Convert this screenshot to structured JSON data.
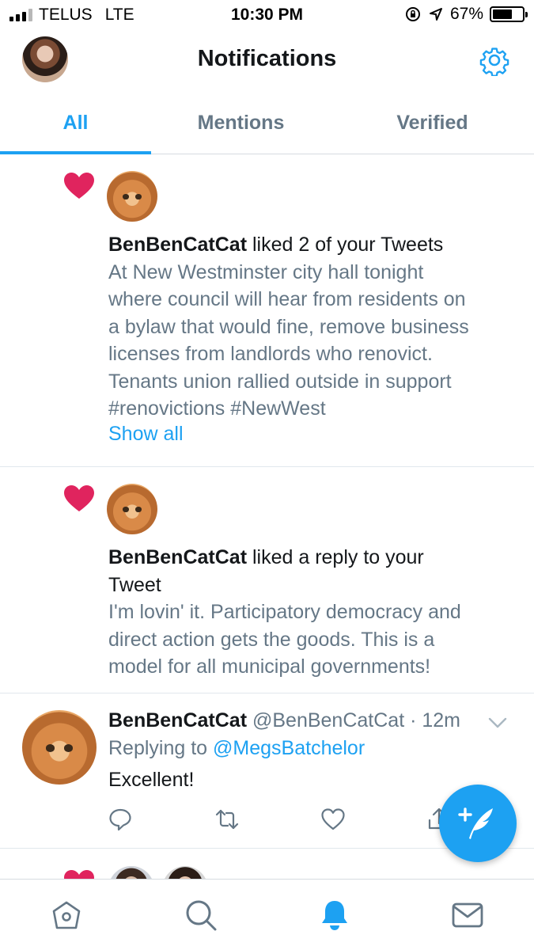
{
  "status_bar": {
    "carrier": "TELUS",
    "network": "LTE",
    "time": "10:30 PM",
    "battery": "67%",
    "battery_level": 0.67
  },
  "header": {
    "title": "Notifications",
    "avatar_icon": "profile-avatar",
    "settings_icon": "gear-icon"
  },
  "tabs": [
    {
      "label": "All",
      "active": true
    },
    {
      "label": "Mentions",
      "active": false
    },
    {
      "label": "Verified",
      "active": false
    }
  ],
  "notifications": [
    {
      "type": "like",
      "actor": "BenBenCatCat",
      "action": " liked 2 of your Tweets",
      "snippet_lines": [
        "At New Westminster city hall tonight",
        "where council will hear from residents on",
        "a bylaw that would fine, remove business",
        "licenses from landlords who renovict.",
        "Tenants union rallied outside in support",
        "#renovictions #NewWest"
      ],
      "show_all": "Show all"
    },
    {
      "type": "like",
      "actor": "BenBenCatCat",
      "action_line1": " liked a reply to your",
      "action_line2": "Tweet",
      "snippet_lines": [
        "I'm lovin' it. Participatory democracy and",
        "direct action gets the goods. This is a",
        "model for all municipal governments!"
      ]
    }
  ],
  "reply_tweet": {
    "name": "BenBenCatCat",
    "handle": "@BenBenCatCat",
    "separator": " · ",
    "time": "12m",
    "replying_prefix": "Replying to ",
    "replying_to": "@MegsBatchelor",
    "text": "Excellent!"
  },
  "colors": {
    "accent": "#1da1f2",
    "like": "#e0245e",
    "secondary_text": "#657786"
  },
  "bottom_nav": [
    "home-icon",
    "search-icon",
    "notifications-bell-icon",
    "messages-envelope-icon"
  ]
}
